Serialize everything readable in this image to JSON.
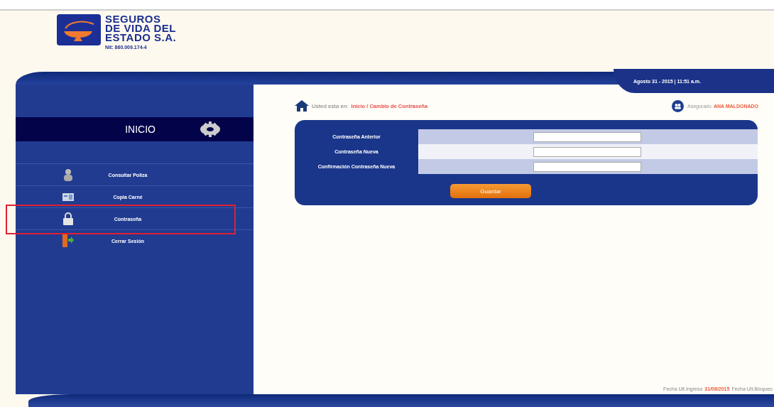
{
  "logo": {
    "name_lines": [
      "SEGUROS",
      "DE VIDA DEL",
      "ESTADO S.A."
    ],
    "nit": "Nit: 860.009.174-4"
  },
  "date_banner": "Agosto 31 - 2015 | 11:51 a.m.",
  "breadcrumb": {
    "prefix": "Usted esta en:",
    "path": "Inicio / Cambio de Contraseña"
  },
  "user": {
    "label": "Asegurado",
    "name": "ANA MALDONADO"
  },
  "sidebar": {
    "title": "INICIO",
    "items": [
      {
        "label": "Consultar Poliza",
        "kind": "person",
        "highlighted": false
      },
      {
        "label": "Copia Carné",
        "kind": "card",
        "highlighted": false
      },
      {
        "label": "Contraseña",
        "kind": "lock",
        "highlighted": true
      },
      {
        "label": "Cerrar Sesión",
        "kind": "exit",
        "highlighted": false
      }
    ]
  },
  "form": {
    "fields": [
      {
        "label": "Contraseña Anterior"
      },
      {
        "label": "Contraseña Nueva"
      },
      {
        "label": "Confirmación Contraseña Nueva"
      }
    ],
    "submit": "Guardar"
  },
  "footer": {
    "last_login_label": "Fecha Ult.Ingreso",
    "last_login_date": "31/08/2015",
    "last_lock_label": "Fecha Ult.Bloqueo"
  }
}
